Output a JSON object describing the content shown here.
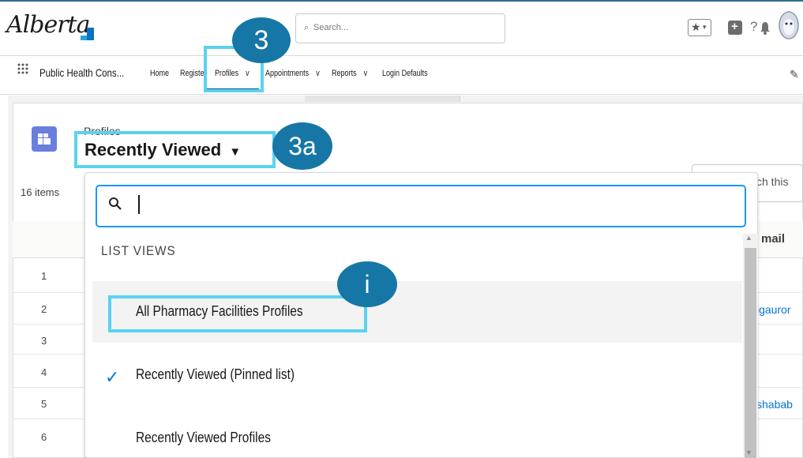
{
  "header": {
    "logo_text": "Alberta",
    "search_placeholder": "Search...",
    "icons": [
      "favorites-icon",
      "add-icon",
      "help-icon",
      "notification-bell-icon",
      "avatar"
    ]
  },
  "nav": {
    "app_name": "Public Health Cons...",
    "items": [
      {
        "label": "Home"
      },
      {
        "label": "Register"
      },
      {
        "label": "Profiles",
        "caret": "v"
      },
      {
        "label": "Appointments",
        "caret": "v"
      },
      {
        "label": "Reports",
        "caret": "v"
      },
      {
        "label": "Login Defaults"
      }
    ]
  },
  "page": {
    "object_label": "Profiles",
    "list_view_title": "Recently Viewed",
    "list_view_caret": "▼",
    "items_count": "16 items",
    "search_list_text": "ch this",
    "column_email": "mail",
    "rows": [
      {
        "num": "1",
        "link": ""
      },
      {
        "num": "2",
        "link": "igauror"
      },
      {
        "num": "3",
        "link": ""
      },
      {
        "num": "4",
        "link": ""
      },
      {
        "num": "5",
        "link": "shabab"
      },
      {
        "num": "6",
        "link": ""
      }
    ]
  },
  "dropdown": {
    "search_value": "",
    "section_header": "LIST VIEWS",
    "items": [
      {
        "label": "All Pharmacy Facilities Profiles",
        "selected": false
      },
      {
        "label": "Recently Viewed (Pinned list)",
        "selected": true
      },
      {
        "label": "Recently Viewed Profiles",
        "selected": false
      }
    ]
  },
  "callouts": {
    "step_3": "3",
    "step_3a": "3a",
    "step_i": "i"
  },
  "colors": {
    "callout_blue": "#1677a6",
    "highlight_cyan": "#5ad2f0",
    "brand_blue": "#0176d3",
    "object_icon": "#6a7ede"
  }
}
